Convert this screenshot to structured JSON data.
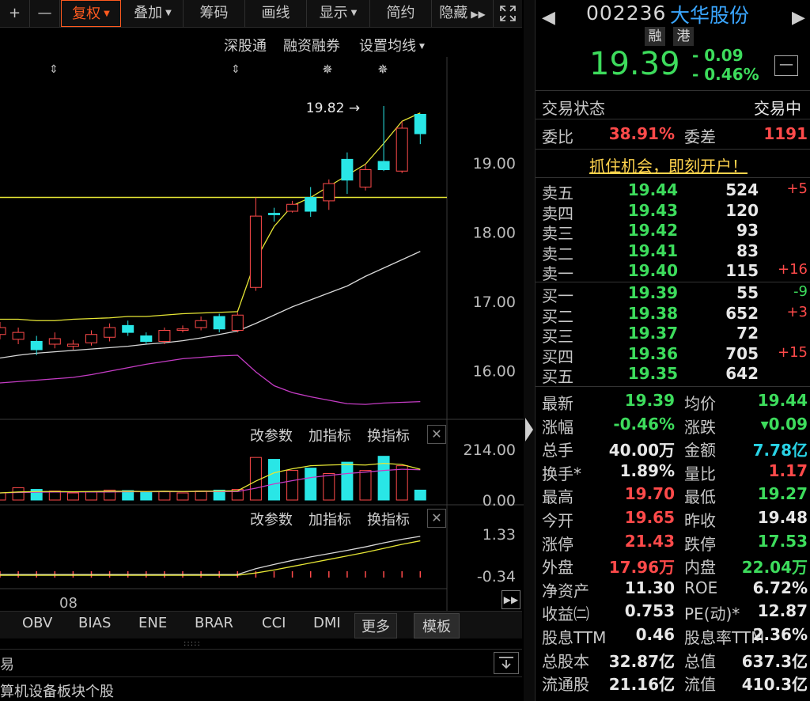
{
  "toolbar": {
    "plus": "+",
    "minus": "—",
    "fuquan": "复权",
    "diejia": "叠加",
    "chouma": "筹码",
    "huaxian": "画线",
    "xianshi": "显示",
    "jianyue": "简约",
    "yincang": "隐藏"
  },
  "subbar": {
    "shengutong": "深股通",
    "rongzi": "融资融券",
    "junxian": "设置均线"
  },
  "chart_data": [
    {
      "type": "candlestick",
      "y_ticks": [
        "19.00",
        "18.00",
        "17.00",
        "16.00"
      ],
      "ylim": [
        15.5,
        20.3
      ],
      "annotation": "19.82",
      "reference_line": 18.5,
      "candles": [
        {
          "o": 16.52,
          "c": 16.62,
          "h": 16.7,
          "l": 16.45
        },
        {
          "o": 16.45,
          "c": 16.55,
          "h": 16.62,
          "l": 16.38
        },
        {
          "o": 16.42,
          "c": 16.3,
          "h": 16.5,
          "l": 16.22
        },
        {
          "o": 16.38,
          "c": 16.46,
          "h": 16.55,
          "l": 16.32
        },
        {
          "o": 16.35,
          "c": 16.38,
          "h": 16.44,
          "l": 16.3
        },
        {
          "o": 16.4,
          "c": 16.52,
          "h": 16.58,
          "l": 16.36
        },
        {
          "o": 16.48,
          "c": 16.62,
          "h": 16.68,
          "l": 16.42
        },
        {
          "o": 16.65,
          "c": 16.55,
          "h": 16.72,
          "l": 16.5
        },
        {
          "o": 16.5,
          "c": 16.42,
          "h": 16.55,
          "l": 16.38
        },
        {
          "o": 16.42,
          "c": 16.58,
          "h": 16.62,
          "l": 16.38
        },
        {
          "o": 16.58,
          "c": 16.6,
          "h": 16.65,
          "l": 16.55
        },
        {
          "o": 16.62,
          "c": 16.72,
          "h": 16.78,
          "l": 16.58
        },
        {
          "o": 16.78,
          "c": 16.6,
          "h": 16.82,
          "l": 16.55
        },
        {
          "o": 16.58,
          "c": 16.8,
          "h": 16.84,
          "l": 16.55
        },
        {
          "o": 17.2,
          "c": 18.23,
          "h": 18.5,
          "l": 17.15
        },
        {
          "o": 18.27,
          "c": 18.25,
          "h": 18.35,
          "l": 18.15
        },
        {
          "o": 18.3,
          "c": 18.4,
          "h": 18.45,
          "l": 18.28
        },
        {
          "o": 18.5,
          "c": 18.3,
          "h": 18.65,
          "l": 18.22
        },
        {
          "o": 18.45,
          "c": 18.7,
          "h": 18.76,
          "l": 18.32
        },
        {
          "o": 19.05,
          "c": 18.75,
          "h": 19.15,
          "l": 18.55
        },
        {
          "o": 18.65,
          "c": 18.9,
          "h": 18.98,
          "l": 18.6
        },
        {
          "o": 19.02,
          "c": 18.9,
          "h": 19.82,
          "l": 18.88
        },
        {
          "o": 18.88,
          "c": 19.5,
          "h": 19.6,
          "l": 18.85
        },
        {
          "o": 19.7,
          "c": 19.42,
          "h": 19.7,
          "l": 19.27
        }
      ],
      "ma_yellow": [
        16.74,
        16.74,
        16.72,
        16.72,
        16.74,
        16.75,
        16.76,
        16.78,
        16.78,
        16.8,
        16.82,
        16.83,
        16.84,
        16.85,
        17.6,
        18.08,
        18.38,
        18.5,
        18.66,
        18.82,
        18.98,
        19.28,
        19.6,
        19.72
      ],
      "ma_white": [
        16.18,
        16.22,
        16.25,
        16.27,
        16.29,
        16.31,
        16.33,
        16.35,
        16.38,
        16.4,
        16.43,
        16.47,
        16.52,
        16.57,
        16.68,
        16.8,
        16.92,
        17.02,
        17.12,
        17.22,
        17.36,
        17.48,
        17.6,
        17.72
      ],
      "ma_magenta": [
        15.82,
        15.84,
        15.86,
        15.88,
        15.9,
        15.94,
        15.99,
        16.04,
        16.09,
        16.13,
        16.17,
        16.19,
        16.21,
        16.22,
        15.98,
        15.78,
        15.68,
        15.62,
        15.57,
        15.52,
        15.51,
        15.53,
        15.54,
        15.55
      ]
    },
    {
      "type": "bar",
      "y_ticks": [
        "214.00",
        "0.00"
      ],
      "ylim": [
        0,
        214
      ],
      "values": [
        30,
        52,
        45,
        38,
        30,
        34,
        42,
        40,
        32,
        36,
        30,
        38,
        42,
        45,
        180,
        172,
        125,
        135,
        112,
        160,
        125,
        185,
        145,
        42
      ],
      "ma_yellow": [
        30,
        34,
        36,
        36,
        35,
        36,
        37,
        37,
        36,
        37,
        36,
        37,
        38,
        39,
        80,
        115,
        132,
        145,
        148,
        150,
        148,
        155,
        150,
        130
      ],
      "ma_magenta": [
        30,
        32,
        33,
        34,
        34,
        34,
        34,
        35,
        35,
        35,
        35,
        36,
        36,
        36,
        50,
        68,
        82,
        95,
        104,
        112,
        118,
        125,
        130,
        128
      ]
    },
    {
      "type": "line",
      "y_ticks": [
        "1.33",
        "-0.34"
      ],
      "ylim": [
        -0.34,
        1.33
      ],
      "white": [
        -0.28,
        -0.28,
        -0.28,
        -0.28,
        -0.28,
        -0.28,
        -0.28,
        -0.28,
        -0.28,
        -0.28,
        -0.28,
        -0.28,
        -0.28,
        -0.28,
        -0.05,
        0.12,
        0.28,
        0.42,
        0.55,
        0.68,
        0.82,
        0.98,
        1.12,
        1.24
      ],
      "yellow": [
        -0.31,
        -0.31,
        -0.31,
        -0.31,
        -0.31,
        -0.31,
        -0.31,
        -0.31,
        -0.31,
        -0.31,
        -0.31,
        -0.31,
        -0.31,
        -0.31,
        -0.22,
        -0.1,
        0.04,
        0.18,
        0.32,
        0.46,
        0.6,
        0.76,
        0.92,
        1.06
      ]
    }
  ],
  "panel_buttons": {
    "gaicanshu": "改参数",
    "jiazhibiao": "加指标",
    "huanzhibiao": "换指标"
  },
  "x_axis_label": "08",
  "bottom_tabs": [
    "OBV",
    "BIAS",
    "ENE",
    "BRAR",
    "CCI",
    "DMI",
    "更多",
    "模板"
  ],
  "status": {
    "left_char": "易",
    "sector": "算机设备板块个股"
  },
  "stock": {
    "code": "002236",
    "name": "大华股份",
    "tag1": "融",
    "tag2": "港",
    "price": "19.39",
    "chg": "- 0.09",
    "pct": "- 0.46%"
  },
  "trade_status": {
    "label": "交易状态",
    "value": "交易中"
  },
  "weibi": {
    "label1": "委比",
    "value1": "38.91%",
    "label2": "委差",
    "value2": "1191"
  },
  "ad": "抓住机会，即刻开户！",
  "asks": [
    {
      "label": "卖五",
      "price": "19.44",
      "vol": "524",
      "delta": "+5"
    },
    {
      "label": "卖四",
      "price": "19.43",
      "vol": "120",
      "delta": ""
    },
    {
      "label": "卖三",
      "price": "19.42",
      "vol": "93",
      "delta": ""
    },
    {
      "label": "卖二",
      "price": "19.41",
      "vol": "83",
      "delta": ""
    },
    {
      "label": "卖一",
      "price": "19.40",
      "vol": "115",
      "delta": "+16"
    }
  ],
  "bids": [
    {
      "label": "买一",
      "price": "19.39",
      "vol": "55",
      "delta": "-9"
    },
    {
      "label": "买二",
      "price": "19.38",
      "vol": "652",
      "delta": "+3"
    },
    {
      "label": "买三",
      "price": "19.37",
      "vol": "72",
      "delta": ""
    },
    {
      "label": "买四",
      "price": "19.36",
      "vol": "705",
      "delta": "+15"
    },
    {
      "label": "买五",
      "price": "19.35",
      "vol": "642",
      "delta": ""
    }
  ],
  "stats": [
    {
      "l1": "最新",
      "v1": "19.39",
      "c1": "grn",
      "l2": "均价",
      "v2": "19.44",
      "c2": "grn"
    },
    {
      "l1": "涨幅",
      "v1": "-0.46%",
      "c1": "grn",
      "l2": "涨跌",
      "v2": "▾0.09",
      "c2": "grn"
    },
    {
      "l1": "总手",
      "v1": "40.00万",
      "c1": "wht",
      "l2": "金额",
      "v2": "7.78亿",
      "c2": "cyan"
    },
    {
      "l1": "换手*",
      "v1": "1.89%",
      "c1": "wht",
      "l2": "量比",
      "v2": "1.17",
      "c2": "red"
    },
    {
      "l1": "最高",
      "v1": "19.70",
      "c1": "red",
      "l2": "最低",
      "v2": "19.27",
      "c2": "grn"
    },
    {
      "l1": "今开",
      "v1": "19.65",
      "c1": "red",
      "l2": "昨收",
      "v2": "19.48",
      "c2": "wht"
    },
    {
      "l1": "涨停",
      "v1": "21.43",
      "c1": "red",
      "l2": "跌停",
      "v2": "17.53",
      "c2": "grn"
    },
    {
      "l1": "外盘",
      "v1": "17.96万",
      "c1": "red",
      "l2": "内盘",
      "v2": "22.04万",
      "c2": "grn"
    },
    {
      "l1": "净资产",
      "v1": "11.30",
      "c1": "wht",
      "l2": "ROE",
      "v2": "6.72%",
      "c2": "wht"
    },
    {
      "l1": "收益㈡",
      "v1": "0.753",
      "c1": "wht",
      "l2": "PE(动)*",
      "v2": "12.87",
      "c2": "wht"
    },
    {
      "l1": "股息TTM",
      "v1": "0.46",
      "c1": "wht",
      "l2": "股息率TTM",
      "v2": "2.36%",
      "c2": "wht"
    },
    {
      "l1": "总股本",
      "v1": "32.87亿",
      "c1": "wht",
      "l2": "总值",
      "v2": "637.3亿",
      "c2": "wht"
    },
    {
      "l1": "流通股",
      "v1": "21.16亿",
      "c1": "wht",
      "l2": "流值",
      "v2": "410.3亿",
      "c2": "wht"
    }
  ]
}
